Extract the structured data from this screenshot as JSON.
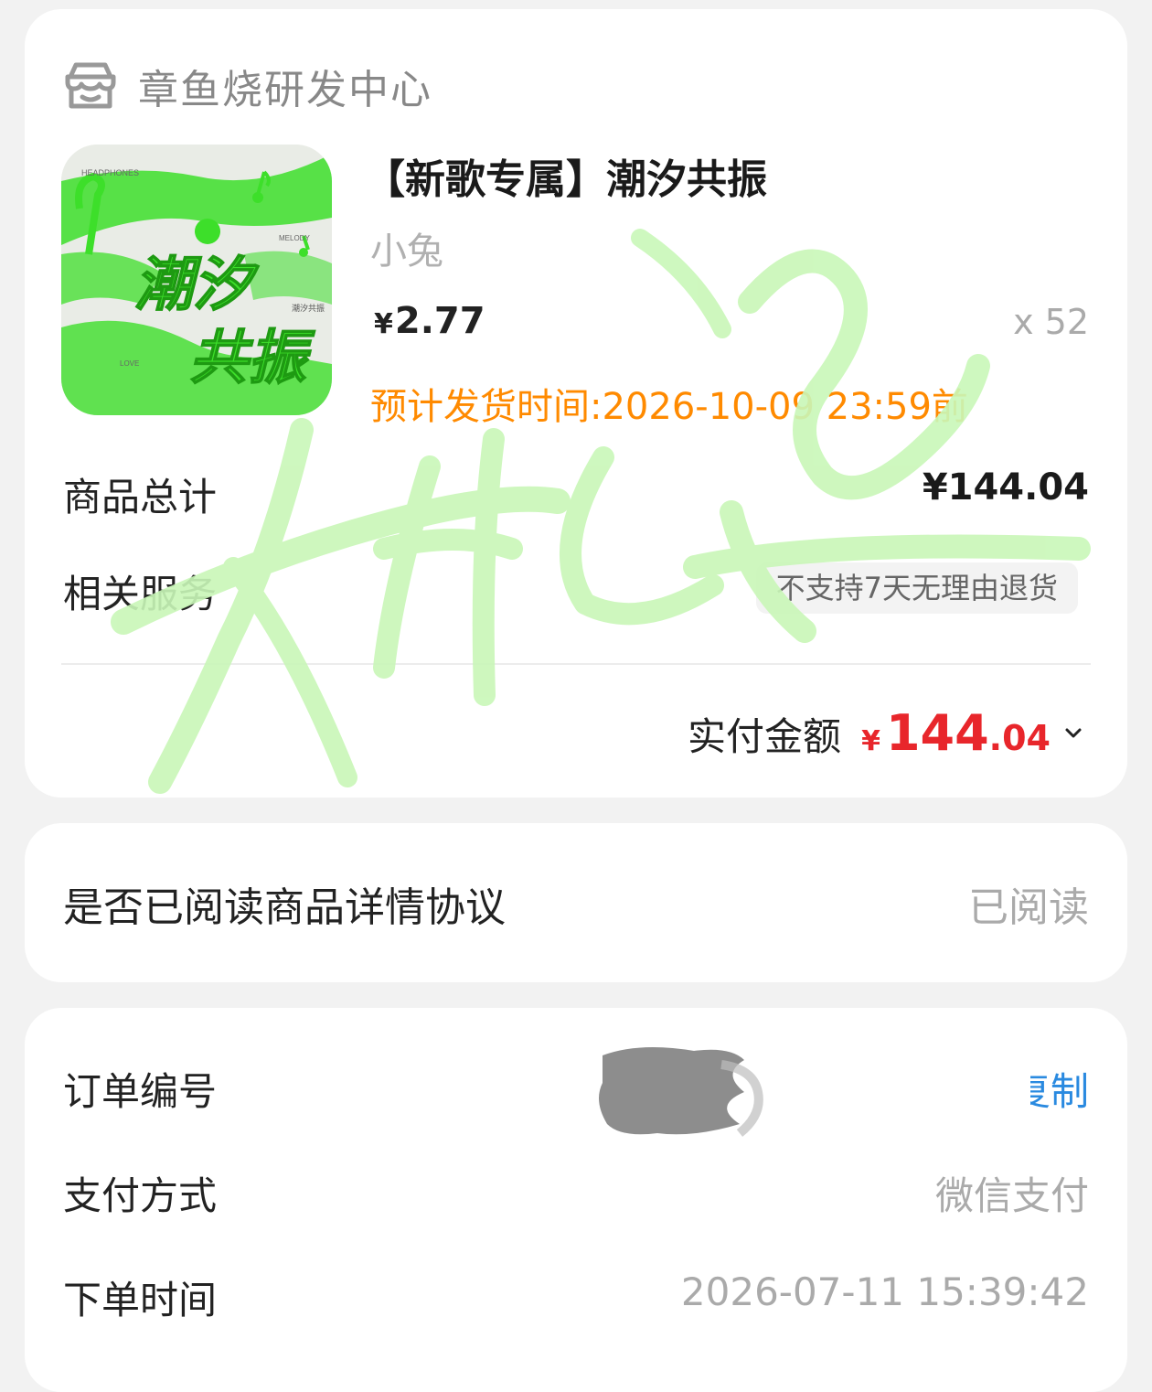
{
  "shop": {
    "name": "章鱼烧研发中心",
    "icon": "shop-icon"
  },
  "product": {
    "title": "【新歌专属】潮汐共振",
    "artist": "小兔",
    "price_symbol": "¥",
    "price": "2.77",
    "quantity": "x 52",
    "shipping": "预计发货时间:2026-10-09 23:59前",
    "cover": {
      "tag_headphones": "HEADPHONES",
      "tag_melody": "MELODY",
      "tag_love": "LOVE",
      "title_line1": "潮汐",
      "title_line2": "共振",
      "small_title": "潮汐共振"
    }
  },
  "summary": {
    "goods_total_label": "商品总计",
    "goods_total_value": "¥144.04",
    "service_label": "相关服务",
    "service_tag": "不支持7天无理由退货",
    "paid_label": "实付金额",
    "paid_symbol": "¥",
    "paid_int": "144",
    "paid_dec": ".04"
  },
  "agreement": {
    "label": "是否已阅读商品详情协议",
    "value": "已阅读"
  },
  "info": {
    "order_no_label": "订单编号",
    "copy_label": "复制",
    "pay_label": "支付方式",
    "pay_value": "微信支付",
    "time_label": "下单时间",
    "time_value": "2026-07-11 15:39:42"
  },
  "colors": {
    "accent_red": "#e8262b",
    "shipping_orange": "#ff8a00",
    "copy_blue": "#2a8ae0",
    "cover_green": "#3ddf2a",
    "watermark_green": "#c9f7b8"
  }
}
